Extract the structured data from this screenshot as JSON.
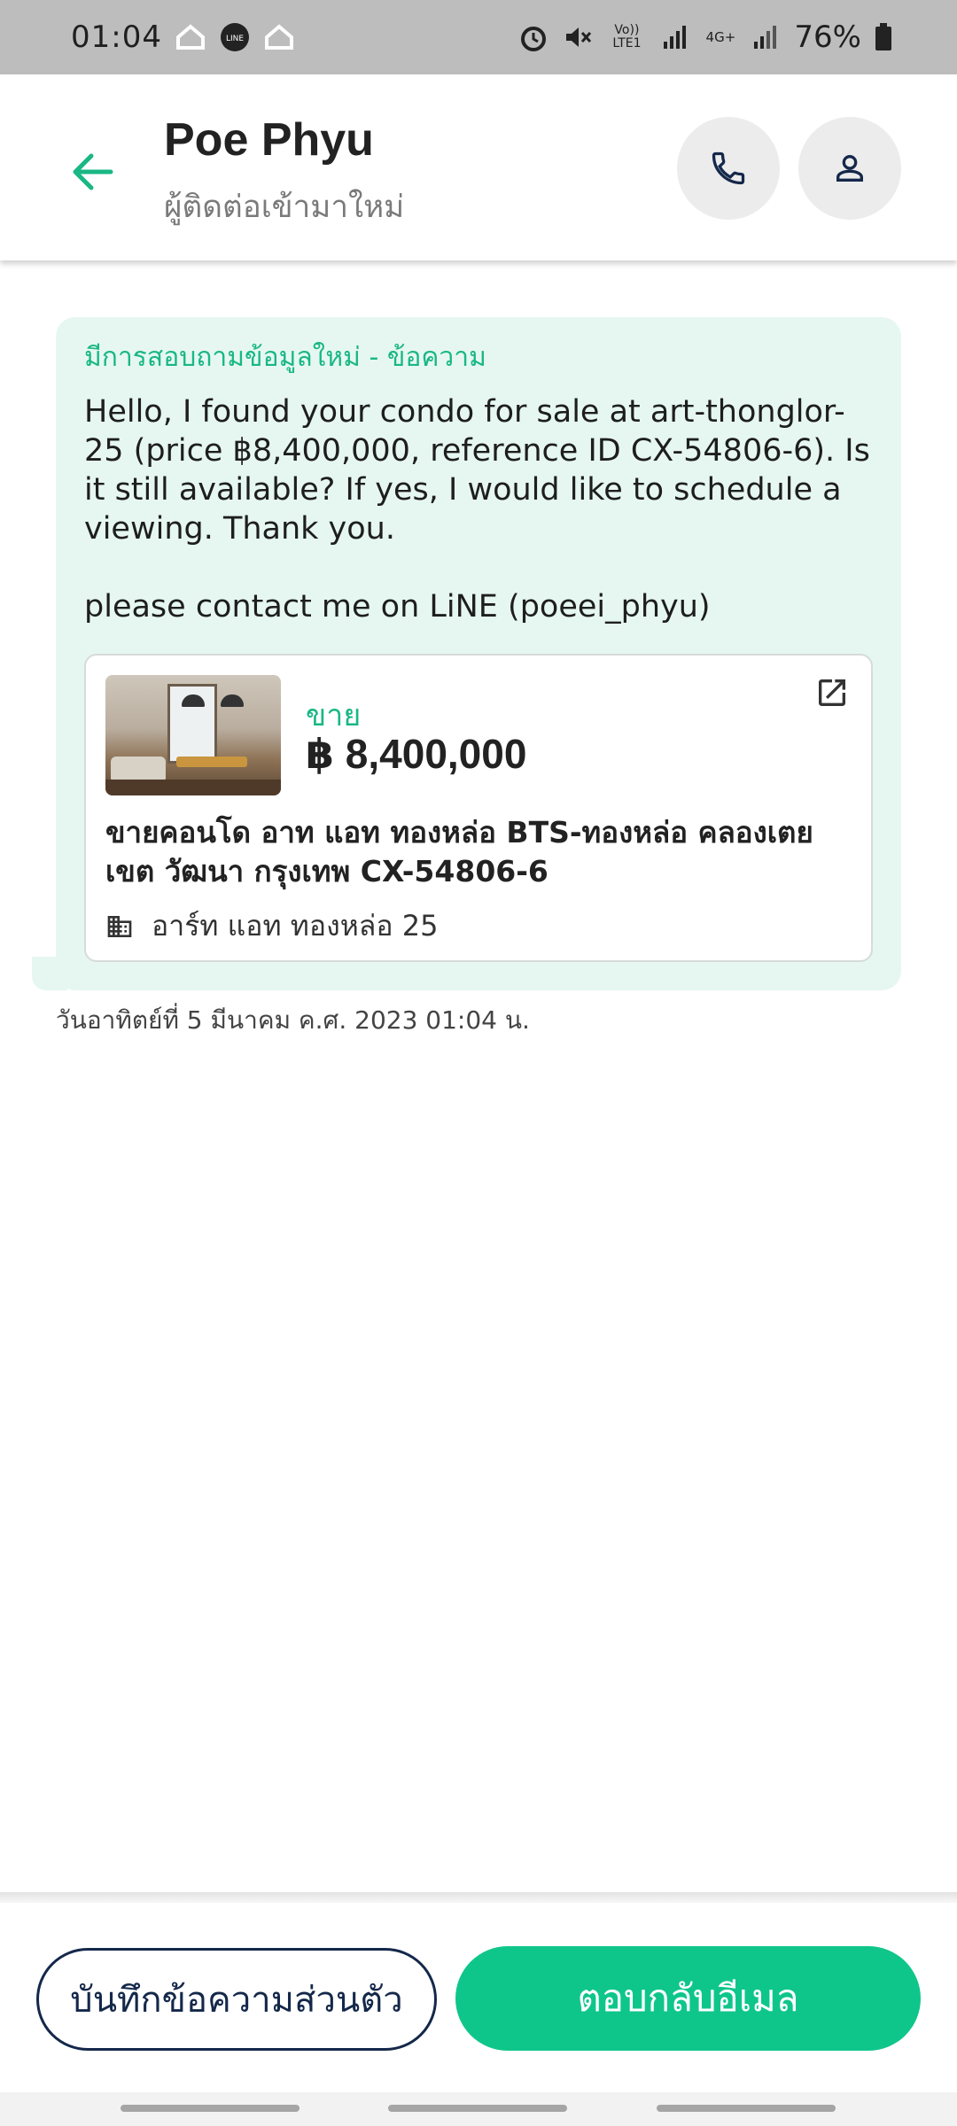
{
  "status_bar": {
    "time": "01:04",
    "battery": "76%",
    "network": "4G+",
    "volte": "Vo)) LTE1",
    "icons": [
      "home-icon",
      "line-app-icon",
      "home-icon",
      "alarm-icon",
      "mute-icon",
      "signal-icon",
      "battery-icon"
    ]
  },
  "header": {
    "name": "Poe Phyu",
    "subtitle": "ผู้ติดต่อเข้ามาใหม่",
    "back_icon": "arrow-left-icon",
    "call_icon": "phone-icon",
    "profile_icon": "person-icon"
  },
  "message": {
    "title": "มีการสอบถามข้อมูลใหม่ - ข้อความ",
    "body": "Hello, I found your condo for sale at art-thonglor-25 (price ฿8,400,000, reference ID CX-54806-6). Is it still available? If yes, I would like to schedule a viewing. Thank you.\n\nplease contact me on LiNE (poeei_phyu)",
    "timestamp": "วันอาทิตย์ที่ 5 มีนาคม ค.ศ. 2023 01:04 น."
  },
  "listing": {
    "type": "ขาย",
    "price": "฿ 8,400,000",
    "title": "ขายคอนโด  อาท แอท ทองหล่อ BTS-ทองหล่อ คลองเตย เขต วัฒนา กรุงเทพ CX-54806-6",
    "project": "อาร์ท แอท ทองหล่อ 25"
  },
  "actions": {
    "note_label": "บันทึกข้อความส่วนตัว",
    "reply_label": "ตอบกลับอีเมล"
  },
  "colors": {
    "accent": "#0fc68a",
    "bubble_bg": "#e6f7f1",
    "navy": "#14284a"
  }
}
